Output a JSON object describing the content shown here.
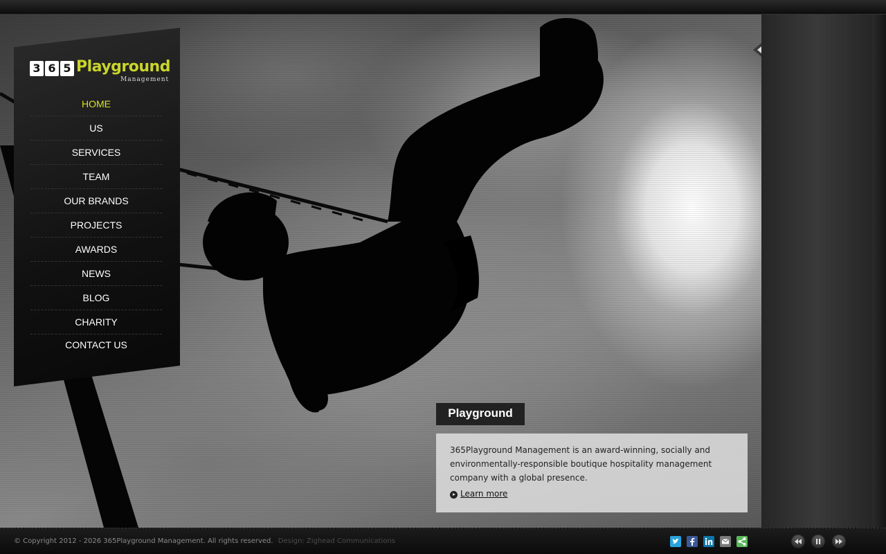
{
  "brand": {
    "digits": [
      "3",
      "6",
      "5"
    ],
    "name": "Playground",
    "subtitle": "Management",
    "accent_color": "#d8e02a"
  },
  "nav": {
    "items": [
      {
        "label": "HOME",
        "active": true
      },
      {
        "label": "US"
      },
      {
        "label": "SERVICES"
      },
      {
        "label": "TEAM"
      },
      {
        "label": "OUR BRANDS"
      },
      {
        "label": "PROJECTS"
      },
      {
        "label": "AWARDS"
      },
      {
        "label": "NEWS"
      },
      {
        "label": "BLOG"
      },
      {
        "label": "CHARITY"
      },
      {
        "label": "CONTACT US"
      }
    ]
  },
  "hero": {
    "image": "swing-silhouette-photo"
  },
  "thumbnails": [
    {
      "icon": "swing-silhouette-thumb",
      "active": true
    },
    {
      "icon": "white-shirts-thumb"
    },
    {
      "icon": "driftwood-signpost-thumb"
    },
    {
      "icon": "smiling-children-thumb"
    },
    {
      "icon": "beach-picnic-thumb"
    },
    {
      "icon": "plated-dish-thumb"
    },
    {
      "icon": "villa-interior-thumb"
    },
    {
      "icon": "puzzle-pieces-thumb"
    }
  ],
  "caption": {
    "title": "Playground",
    "text": "365Playground Management is an award-winning, socially and environmentally-responsible boutique hospitality management company with a global presence.",
    "link": "Learn more"
  },
  "footer": {
    "copyright": "© Copyright 2012 - 2026 365Playground Management. All rights reserved.",
    "credit": "Design: Zighead Communications",
    "social": [
      {
        "icon": "twitter-icon",
        "color": "#2aa3dc"
      },
      {
        "icon": "facebook-icon",
        "color": "#3b5998"
      },
      {
        "icon": "linkedin-icon",
        "color": "#0e76a8"
      },
      {
        "icon": "email-icon",
        "color": "#7a7a7a"
      },
      {
        "icon": "share-icon",
        "color": "#5cb85c"
      }
    ],
    "controls": [
      "previous-icon",
      "pause-icon",
      "next-icon"
    ]
  }
}
